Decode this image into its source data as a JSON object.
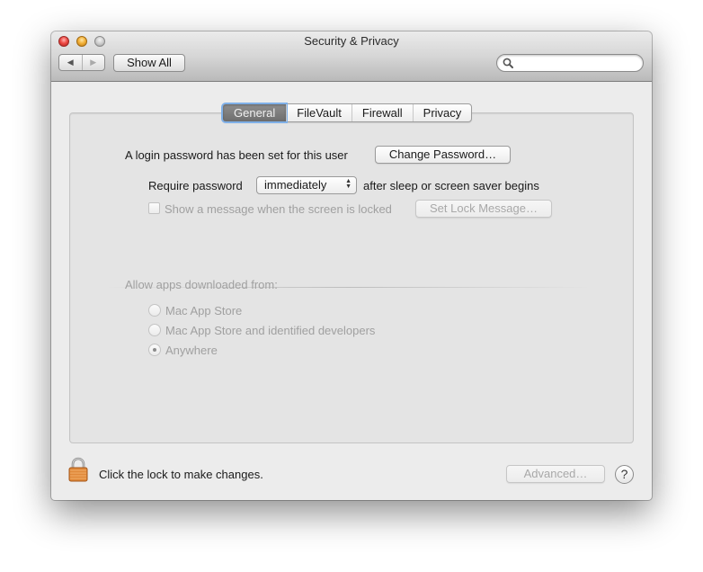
{
  "window": {
    "title": "Security & Privacy",
    "controls": [
      "close",
      "minimize",
      "zoom"
    ]
  },
  "toolbar": {
    "back_icon": "◀",
    "forward_icon": "▶",
    "show_all_label": "Show All",
    "search": {
      "value": "",
      "placeholder": ""
    }
  },
  "tabs": [
    {
      "label": "General",
      "active": true
    },
    {
      "label": "FileVault",
      "active": false
    },
    {
      "label": "Firewall",
      "active": false
    },
    {
      "label": "Privacy",
      "active": false
    }
  ],
  "general": {
    "login_password_text": "A login password has been set for this user",
    "change_password_label": "Change Password…",
    "require_password_label": "Require password",
    "require_password_value": "immediately",
    "require_password_suffix": "after sleep or screen saver begins",
    "show_message_label": "Show a message when the screen is locked",
    "show_message_checked": false,
    "set_lock_message_label": "Set Lock Message…",
    "allow_apps_label": "Allow apps downloaded from:",
    "allow_apps_options": [
      {
        "label": "Mac App Store",
        "selected": false
      },
      {
        "label": "Mac App Store and identified developers",
        "selected": false
      },
      {
        "label": "Anywhere",
        "selected": true
      }
    ]
  },
  "footer": {
    "lock_text": "Click the lock to make changes.",
    "advanced_label": "Advanced…",
    "help_label": "?"
  }
}
